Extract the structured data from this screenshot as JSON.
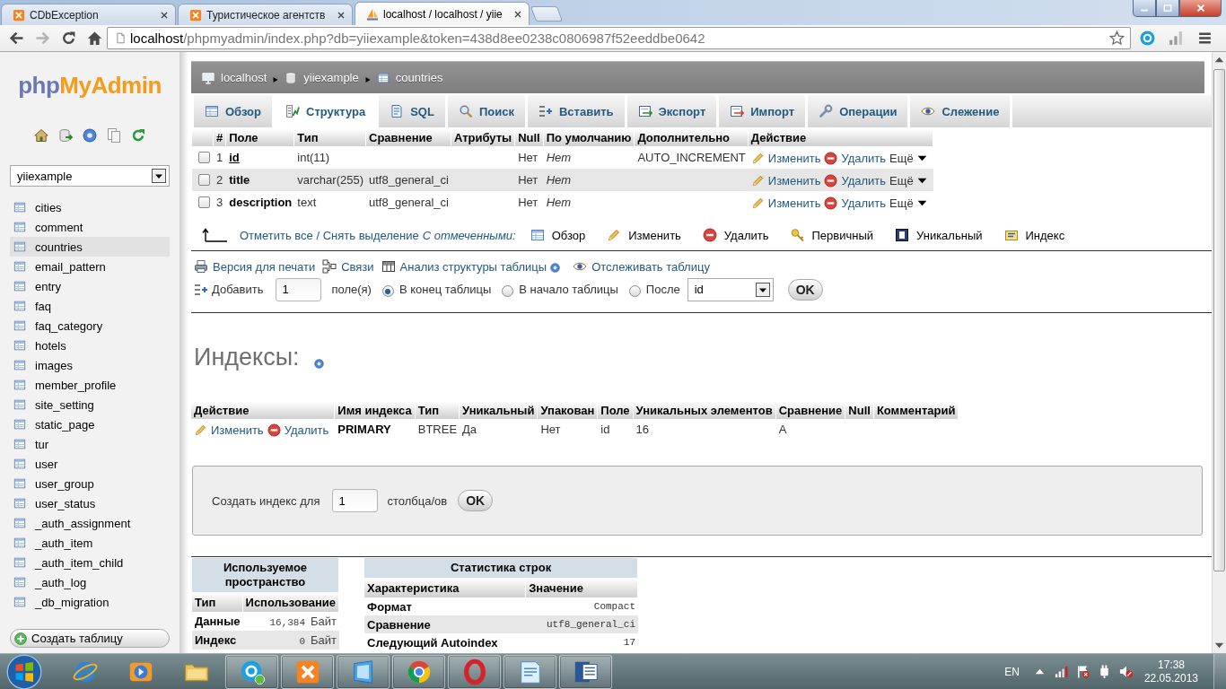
{
  "browser": {
    "tabs": [
      {
        "kind": "tile",
        "title": "CDbException",
        "selected": false
      },
      {
        "kind": "tile",
        "title": "Туристическое агентств",
        "selected": false
      },
      {
        "kind": "sail",
        "title": "localhost / localhost / yiie",
        "selected": true
      }
    ],
    "address": {
      "host": "localhost",
      "path": "/phpmyadmin/index.php?db=yiiexample&token=438d8ee0238c0806987f52eeddbe0642"
    }
  },
  "sidebar": {
    "logo": {
      "first": "php",
      "second": "MyAdmin"
    },
    "database": "yiiexample",
    "tables": [
      {
        "name": "cities",
        "selected": false
      },
      {
        "name": "comment",
        "selected": false
      },
      {
        "name": "countries",
        "selected": true
      },
      {
        "name": "email_pattern",
        "selected": false
      },
      {
        "name": "entry",
        "selected": false
      },
      {
        "name": "faq",
        "selected": false
      },
      {
        "name": "faq_category",
        "selected": false
      },
      {
        "name": "hotels",
        "selected": false
      },
      {
        "name": "images",
        "selected": false
      },
      {
        "name": "member_profile",
        "selected": false
      },
      {
        "name": "site_setting",
        "selected": false
      },
      {
        "name": "static_page",
        "selected": false
      },
      {
        "name": "tur",
        "selected": false
      },
      {
        "name": "user",
        "selected": false
      },
      {
        "name": "user_group",
        "selected": false
      },
      {
        "name": "user_status",
        "selected": false
      },
      {
        "name": "_auth_assignment",
        "selected": false
      },
      {
        "name": "_auth_item",
        "selected": false
      },
      {
        "name": "_auth_item_child",
        "selected": false
      },
      {
        "name": "_auth_log",
        "selected": false
      },
      {
        "name": "_db_migration",
        "selected": false
      }
    ],
    "create_button": "Создать таблицу"
  },
  "breadcrumb": [
    {
      "kind": "server",
      "label": "localhost"
    },
    {
      "kind": "database",
      "label": "yiiexample"
    },
    {
      "kind": "table",
      "label": "countries"
    }
  ],
  "tabs": [
    {
      "kind": "browse",
      "label": "Обзор",
      "selected": false
    },
    {
      "kind": "structure",
      "label": "Структура",
      "selected": true
    },
    {
      "kind": "sql",
      "label": "SQL",
      "selected": false
    },
    {
      "kind": "search",
      "label": "Поиск",
      "selected": false
    },
    {
      "kind": "insert",
      "label": "Вставить",
      "selected": false
    },
    {
      "kind": "export",
      "label": "Экспорт",
      "selected": false
    },
    {
      "kind": "import",
      "label": "Импорт",
      "selected": false
    },
    {
      "kind": "operations",
      "label": "Операции",
      "selected": false
    },
    {
      "kind": "tracking",
      "label": "Слежение",
      "selected": false
    }
  ],
  "structure": {
    "columns": [
      "#",
      "Поле",
      "Тип",
      "Сравнение",
      "Атрибуты",
      "Null",
      "По умолчанию",
      "Дополнительно",
      "Действие"
    ],
    "rows": [
      {
        "checked": false,
        "number": "1",
        "name": "id",
        "primary": true,
        "type": "int(11)",
        "null": "Нет",
        "default": "Нет",
        "extra": "AUTO_INCREMENT",
        "actions": [
          {
            "kind": "edit",
            "label": "Изменить"
          },
          {
            "kind": "drop",
            "label": "Удалить"
          },
          {
            "kind": "more",
            "label": "Ещё"
          }
        ]
      },
      {
        "checked": false,
        "number": "2",
        "name": "title",
        "primary": false,
        "type": "varchar(255)",
        "collation": "utf8_general_ci",
        "null": "Нет",
        "default": "Нет",
        "actions": [
          {
            "kind": "edit",
            "label": "Изменить"
          },
          {
            "kind": "drop",
            "label": "Удалить"
          },
          {
            "kind": "more",
            "label": "Ещё"
          }
        ]
      },
      {
        "checked": false,
        "number": "3",
        "name": "description",
        "primary": false,
        "type": "text",
        "collation": "utf8_general_ci",
        "null": "Нет",
        "default": "Нет",
        "actions": [
          {
            "kind": "edit",
            "label": "Изменить"
          },
          {
            "kind": "drop",
            "label": "Удалить"
          },
          {
            "kind": "more",
            "label": "Ещё"
          }
        ]
      }
    ]
  },
  "with_selected": {
    "check_all": "Отметить все / Снять выделение",
    "label": "С отмеченными:",
    "actions": [
      {
        "kind": "browse",
        "label": "Обзор"
      },
      {
        "kind": "edit",
        "label": "Изменить"
      },
      {
        "kind": "drop",
        "label": "Удалить"
      },
      {
        "kind": "primary",
        "label": "Первичный"
      },
      {
        "kind": "unique",
        "label": "Уникальный"
      },
      {
        "kind": "index",
        "label": "Индекс"
      }
    ]
  },
  "links": [
    {
      "kind": "print",
      "label": "Версия для печати"
    },
    {
      "kind": "relations",
      "label": "Связи"
    },
    {
      "kind": "analyze",
      "label": "Анализ структуры таблицы"
    },
    {
      "kind": "track",
      "label": "Отслеживать таблицу"
    }
  ],
  "add_fields": {
    "label": "Добавить",
    "count": "1",
    "unit": "поле(я)",
    "positions": [
      {
        "label": "В конец таблицы",
        "selected": true
      },
      {
        "label": "В начало таблицы",
        "selected": false
      },
      {
        "label": "После",
        "selected": false
      }
    ],
    "after_column": "id",
    "ok": "OK"
  },
  "indexes": {
    "title": "Индексы:",
    "columns": [
      "Действие",
      "Имя индекса",
      "Тип",
      "Уникальный",
      "Упакован",
      "Поле",
      "Уникальных элементов",
      "Сравнение",
      "Null",
      "Комментарий"
    ],
    "rows": [
      {
        "actions": [
          {
            "kind": "edit",
            "label": "Изменить"
          },
          {
            "kind": "drop",
            "label": "Удалить"
          }
        ],
        "name": "PRIMARY",
        "type": "BTREE",
        "unique": "Да",
        "packed": "Нет",
        "field": "id",
        "cardinality": "16",
        "collation": "A"
      }
    ]
  },
  "create_index": {
    "label": "Создать индекс для",
    "count": "1",
    "unit": "столбца/ов",
    "ok": "OK"
  },
  "space_usage": {
    "title": "Используемое пространство",
    "columns": [
      "Тип",
      "Использование"
    ],
    "rows": [
      {
        "type": "Данные",
        "value": "16,384",
        "unit": "Байт"
      },
      {
        "type": "Индекс",
        "value": "0",
        "unit": "Байт"
      }
    ]
  },
  "row_stats": {
    "title": "Статистика строк",
    "columns": [
      "Характеристика",
      "Значение"
    ],
    "rows": [
      {
        "name": "Формат",
        "value": "Compact"
      },
      {
        "name": "Сравнение",
        "value": "utf8_general_ci"
      },
      {
        "name": "Следующий Autoindex",
        "value": "17"
      }
    ]
  },
  "taskbar": {
    "apps": [
      {
        "kind": "orbit",
        "running": false
      },
      {
        "kind": "player",
        "running": false
      },
      {
        "kind": "folder",
        "running": false
      },
      {
        "kind": "chat",
        "running": true
      },
      {
        "kind": "xtile",
        "running": true
      },
      {
        "kind": "window",
        "running": true
      },
      {
        "kind": "wheel",
        "running": true
      },
      {
        "kind": "ring",
        "running": true
      },
      {
        "kind": "notepad",
        "running": true
      },
      {
        "kind": "document",
        "running": true
      }
    ],
    "language": "EN",
    "time": "17:38",
    "date": "22.05.2013"
  }
}
